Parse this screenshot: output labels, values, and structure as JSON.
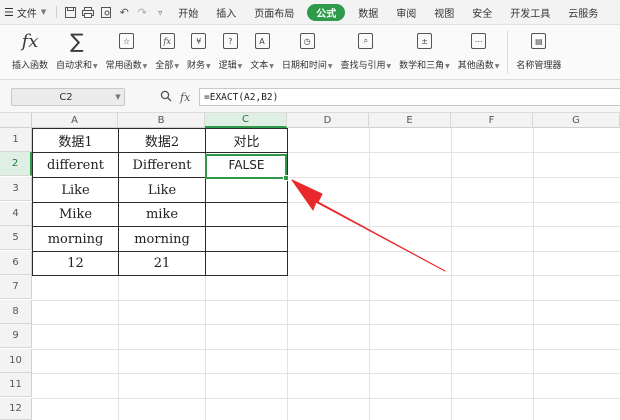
{
  "menubar": {
    "file_label": "文件",
    "tabs": [
      "开始",
      "插入",
      "页面布局",
      "公式",
      "数据",
      "审阅",
      "视图",
      "安全",
      "开发工具",
      "云服务"
    ],
    "active_tab": "公式"
  },
  "ribbon": {
    "items": [
      {
        "label": "插入函数",
        "icon": "fx-icon",
        "dropdown": false
      },
      {
        "label": "自动求和",
        "icon": "sigma-icon",
        "dropdown": true
      },
      {
        "label": "常用函数",
        "icon": "star-fx-icon",
        "dropdown": true
      },
      {
        "label": "全部",
        "icon": "fx-box-icon",
        "dropdown": true
      },
      {
        "label": "财务",
        "icon": "yen-icon",
        "dropdown": true
      },
      {
        "label": "逻辑",
        "icon": "question-box-icon",
        "dropdown": true
      },
      {
        "label": "文本",
        "icon": "text-a-icon",
        "dropdown": true
      },
      {
        "label": "日期和时间",
        "icon": "clock-icon",
        "dropdown": true
      },
      {
        "label": "查找与引用",
        "icon": "search-box-icon",
        "dropdown": true
      },
      {
        "label": "数学和三角",
        "icon": "math-icon",
        "dropdown": true
      },
      {
        "label": "其他函数",
        "icon": "more-icon",
        "dropdown": true
      },
      {
        "label": "名称管理器",
        "icon": "name-manager-icon",
        "dropdown": false
      }
    ]
  },
  "formula_bar": {
    "name_box": "C2",
    "fx_label": "fx",
    "formula": "=EXACT(A2,B2)"
  },
  "sheet": {
    "columns": [
      "A",
      "B",
      "C",
      "D",
      "E",
      "F",
      "G"
    ],
    "rows": [
      "1",
      "2",
      "3",
      "4",
      "5",
      "6",
      "7",
      "8",
      "9",
      "10",
      "11",
      "12"
    ],
    "selected_cell": "C2",
    "table": [
      [
        "数据1",
        "数据2",
        "对比"
      ],
      [
        "different",
        "Different",
        "FALSE"
      ],
      [
        "Like",
        "Like",
        ""
      ],
      [
        "Mike",
        "mike",
        ""
      ],
      [
        "morning",
        "morning",
        ""
      ],
      [
        "12",
        "21",
        ""
      ]
    ]
  },
  "colors": {
    "accent": "#2e9a4a",
    "annotation_arrow": "#e8282b"
  }
}
